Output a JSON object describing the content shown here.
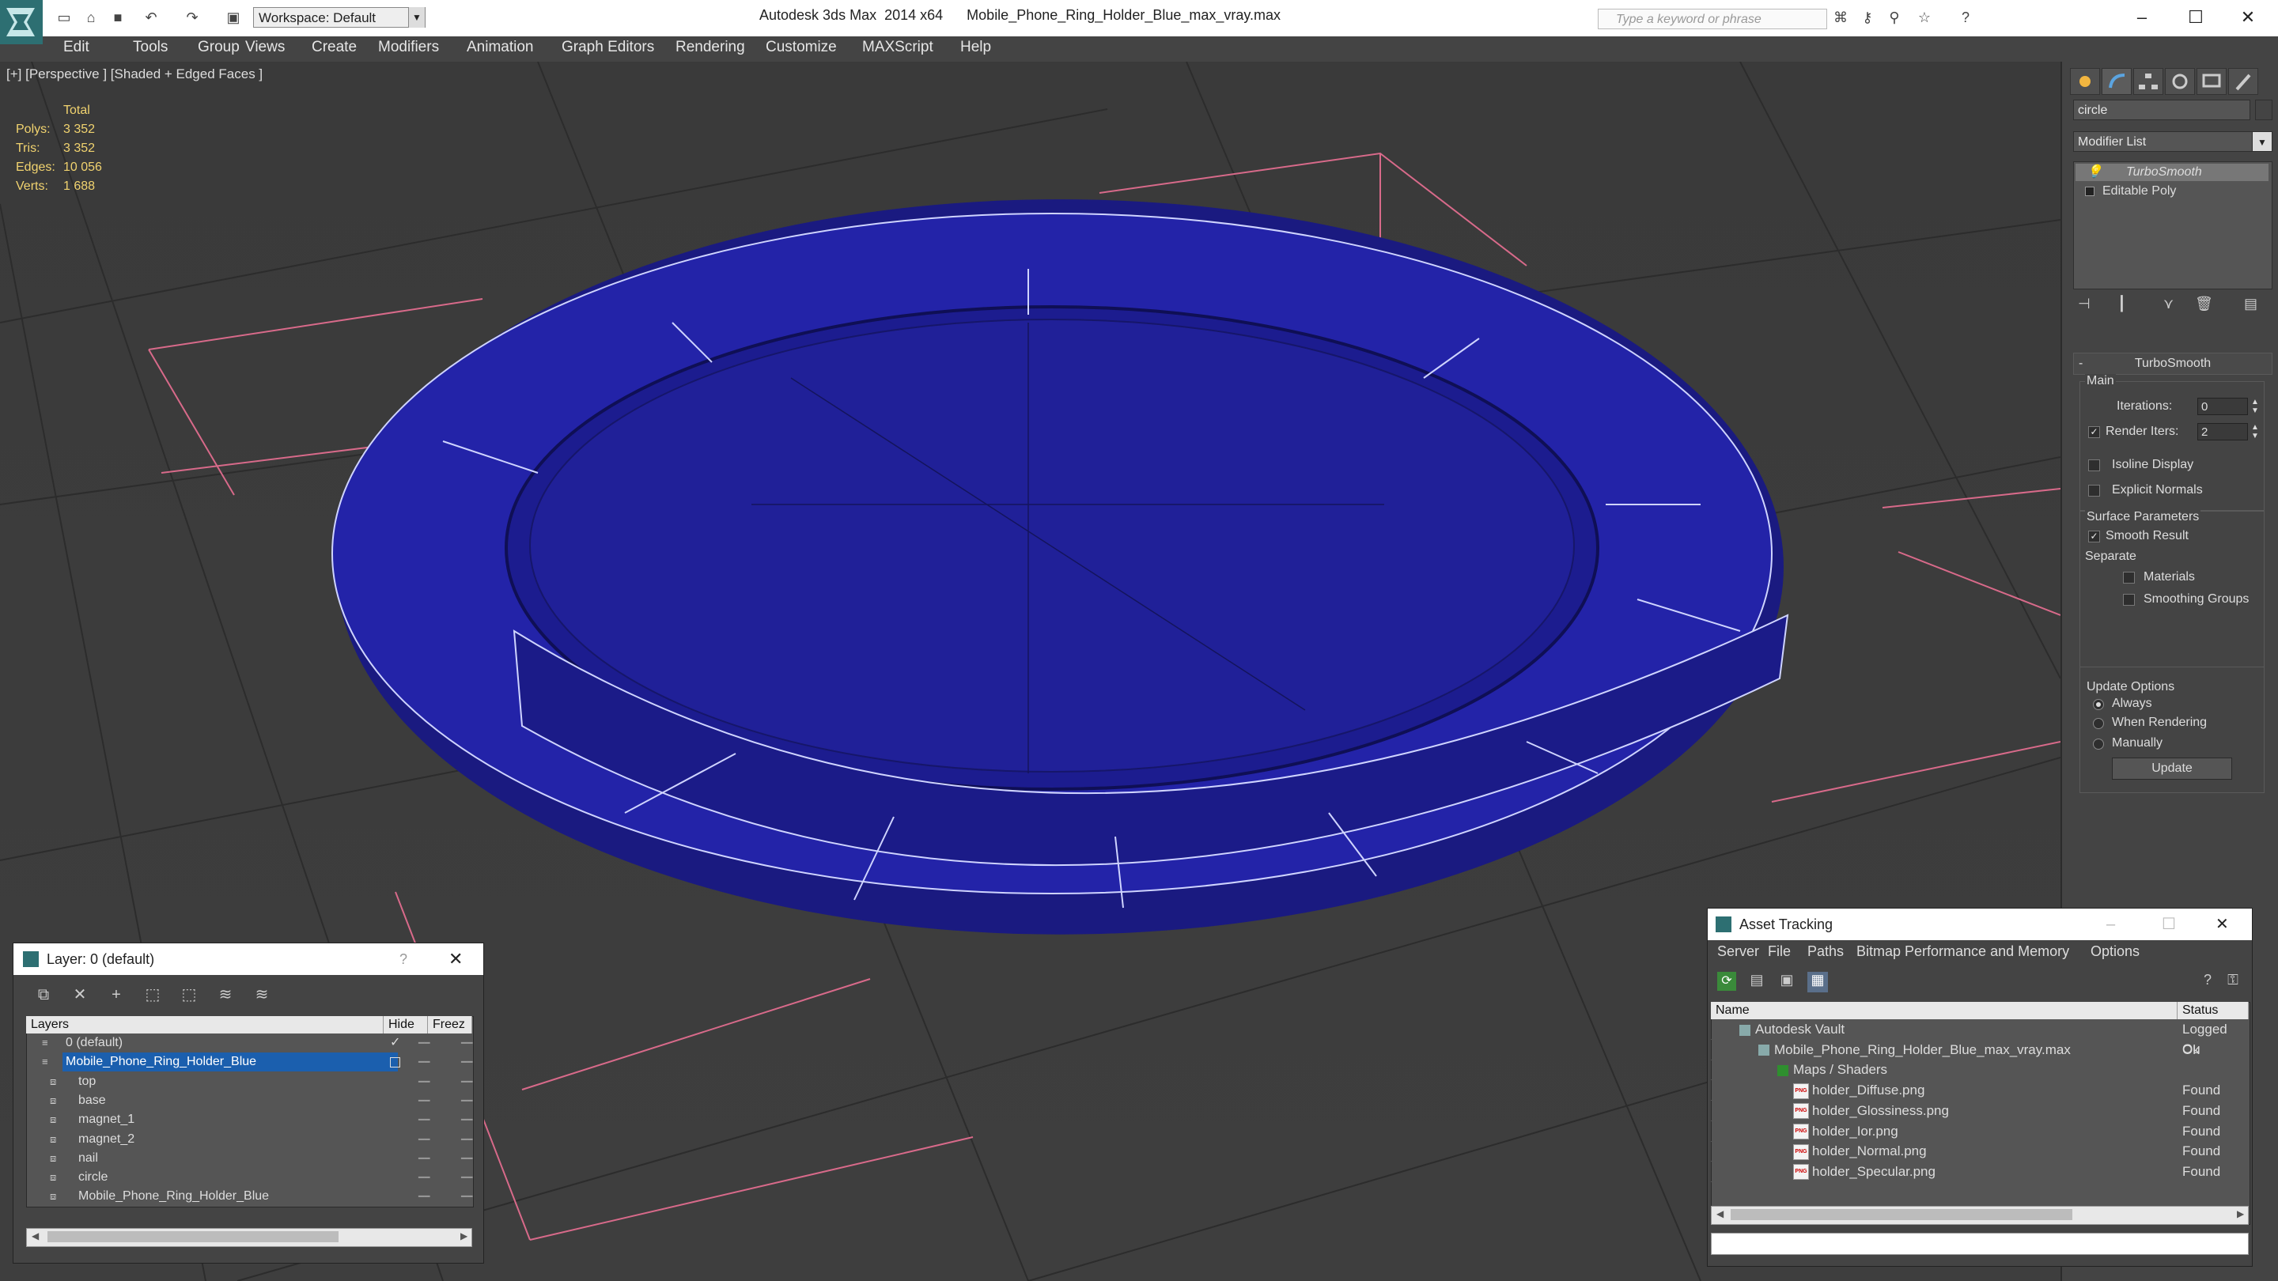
{
  "window": {
    "app_title": "Autodesk 3ds Max  2014 x64",
    "file_title": "Mobile_Phone_Ring_Holder_Blue_max_vray.max",
    "workspace": "Workspace: Default",
    "search_placeholder": "Type a keyword or phrase"
  },
  "menu": [
    "Edit",
    "Tools",
    "Group",
    "Views",
    "Create",
    "Modifiers",
    "Animation",
    "Graph Editors",
    "Rendering",
    "Customize",
    "MAXScript",
    "Help"
  ],
  "viewport": {
    "label": "[+] [Perspective ] [Shaded + Edged Faces ]",
    "stats_header": "Total",
    "stats": [
      {
        "key": "Polys:",
        "value": "3 352"
      },
      {
        "key": "Tris:",
        "value": "3 352"
      },
      {
        "key": "Edges:",
        "value": "10 056"
      },
      {
        "key": "Verts:",
        "value": "1 688"
      }
    ],
    "model_color": "#2121a0"
  },
  "command_panel": {
    "object_name": "circle",
    "modifier_list": "Modifier List",
    "stack": [
      "TurboSmooth",
      "Editable Poly"
    ],
    "rollout_title": "TurboSmooth",
    "main_group": "Main",
    "iterations_label": "Iterations:",
    "iterations": "0",
    "render_iters_label": "Render Iters:",
    "render_iters": "2",
    "isoline": "Isoline Display",
    "explicit_normals": "Explicit Normals",
    "surface_params": "Surface Parameters",
    "smooth_result": "Smooth Result",
    "separate": "Separate",
    "materials": "Materials",
    "smoothing_groups": "Smoothing Groups",
    "update_options": "Update Options",
    "always": "Always",
    "when_rendering": "When Rendering",
    "manually": "Manually",
    "update_button": "Update"
  },
  "layer_dialog": {
    "title": "Layer: 0 (default)",
    "help": "?",
    "columns": [
      "Layers",
      "Hide",
      "Freez"
    ],
    "rows": [
      {
        "name": "0 (default)",
        "level": 0,
        "selected": false
      },
      {
        "name": "Mobile_Phone_Ring_Holder_Blue",
        "level": 0,
        "selected": true
      },
      {
        "name": "top",
        "level": 1,
        "selected": false
      },
      {
        "name": "base",
        "level": 1,
        "selected": false
      },
      {
        "name": "magnet_1",
        "level": 1,
        "selected": false
      },
      {
        "name": "magnet_2",
        "level": 1,
        "selected": false
      },
      {
        "name": "nail",
        "level": 1,
        "selected": false
      },
      {
        "name": "circle",
        "level": 1,
        "selected": false
      },
      {
        "name": "Mobile_Phone_Ring_Holder_Blue",
        "level": 1,
        "selected": false
      }
    ]
  },
  "asset_dialog": {
    "title": "Asset Tracking",
    "menu": [
      "Server",
      "File",
      "Paths",
      "Bitmap Performance and Memory",
      "Options"
    ],
    "columns": [
      "Name",
      "Status"
    ],
    "rows": [
      {
        "name": "Autodesk Vault",
        "status": "Logged Ou",
        "indent": 0
      },
      {
        "name": "Mobile_Phone_Ring_Holder_Blue_max_vray.max",
        "status": "Ok",
        "indent": 1
      },
      {
        "name": "Maps / Shaders",
        "status": "",
        "indent": 2
      },
      {
        "name": "holder_Diffuse.png",
        "status": "Found",
        "indent": 3
      },
      {
        "name": "holder_Glossiness.png",
        "status": "Found",
        "indent": 3
      },
      {
        "name": "holder_Ior.png",
        "status": "Found",
        "indent": 3
      },
      {
        "name": "holder_Normal.png",
        "status": "Found",
        "indent": 3
      },
      {
        "name": "holder_Specular.png",
        "status": "Found",
        "indent": 3
      }
    ]
  }
}
